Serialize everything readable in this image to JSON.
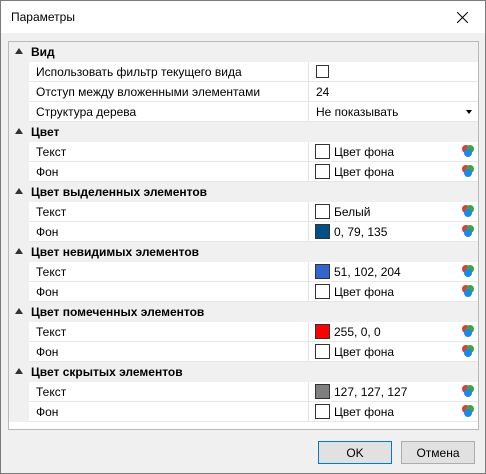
{
  "window": {
    "title": "Параметры"
  },
  "sections": {
    "view": {
      "title": "Вид",
      "use_filter_label": "Использовать фильтр текущего вида",
      "indent_label": "Отступ между вложенными элементами",
      "indent_value": "24",
      "tree_label": "Структура дерева",
      "tree_value": "Не показывать"
    },
    "color": {
      "title": "Цвет",
      "text_label": "Текст",
      "text_value": "Цвет фона",
      "bg_label": "Фон",
      "bg_value": "Цвет фона"
    },
    "selected": {
      "title": "Цвет выделенных элементов",
      "text_label": "Текст",
      "text_value": "Белый",
      "text_color": "#ffffff",
      "bg_label": "Фон",
      "bg_value": "0, 79, 135",
      "bg_color": "#004f87"
    },
    "invisible": {
      "title": "Цвет невидимых элементов",
      "text_label": "Текст",
      "text_value": "51, 102, 204",
      "text_color": "#3366cc",
      "bg_label": "Фон",
      "bg_value": "Цвет фона"
    },
    "marked": {
      "title": "Цвет помеченных элементов",
      "text_label": "Текст",
      "text_value": "255, 0, 0",
      "text_color": "#ff0000",
      "bg_label": "Фон",
      "bg_value": "Цвет фона"
    },
    "hidden": {
      "title": "Цвет скрытых элементов",
      "text_label": "Текст",
      "text_value": "127, 127, 127",
      "text_color": "#7f7f7f",
      "bg_label": "Фон",
      "bg_value": "Цвет фона"
    }
  },
  "buttons": {
    "ok": "OK",
    "cancel": "Отмена"
  }
}
